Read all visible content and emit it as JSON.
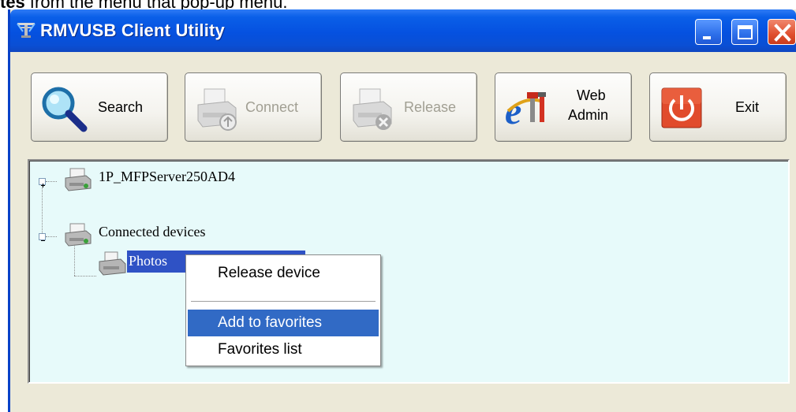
{
  "caption": {
    "bold": "tes",
    "rest": " from the menu that pop-up menu."
  },
  "window": {
    "title": "RMVUSB Client Utility"
  },
  "titlebar_buttons": {
    "minimize": "minimize",
    "maximize": "maximize",
    "close": "close"
  },
  "toolbar": {
    "search": {
      "label": "Search",
      "icon": "magnifier-icon",
      "enabled": true
    },
    "connect": {
      "label": "Connect",
      "icon": "printer-connect-icon",
      "enabled": false
    },
    "release": {
      "label": "Release",
      "icon": "printer-release-icon",
      "enabled": false
    },
    "webadmin": {
      "label_line1": "Web",
      "label_line2": "Admin",
      "icon": "ie-tools-icon",
      "enabled": true
    },
    "exit": {
      "label": "Exit",
      "icon": "power-icon",
      "enabled": true
    }
  },
  "tree": {
    "server": {
      "label": "1P_MFPServer250AD4",
      "expander": "+"
    },
    "connected": {
      "label": "Connected devices",
      "expander": "-"
    },
    "device": {
      "label": "Photos",
      "selected": true
    }
  },
  "context_menu": {
    "items": [
      {
        "label": "Release device",
        "highlighted": false
      },
      {
        "label": "Add to favorites",
        "highlighted": true
      },
      {
        "label": "Favorites list",
        "highlighted": false
      }
    ]
  },
  "colors": {
    "titlebar": "#0551e0",
    "selection": "#316ac5",
    "tree_background": "#e7fafa",
    "window_face": "#ece9d8"
  }
}
